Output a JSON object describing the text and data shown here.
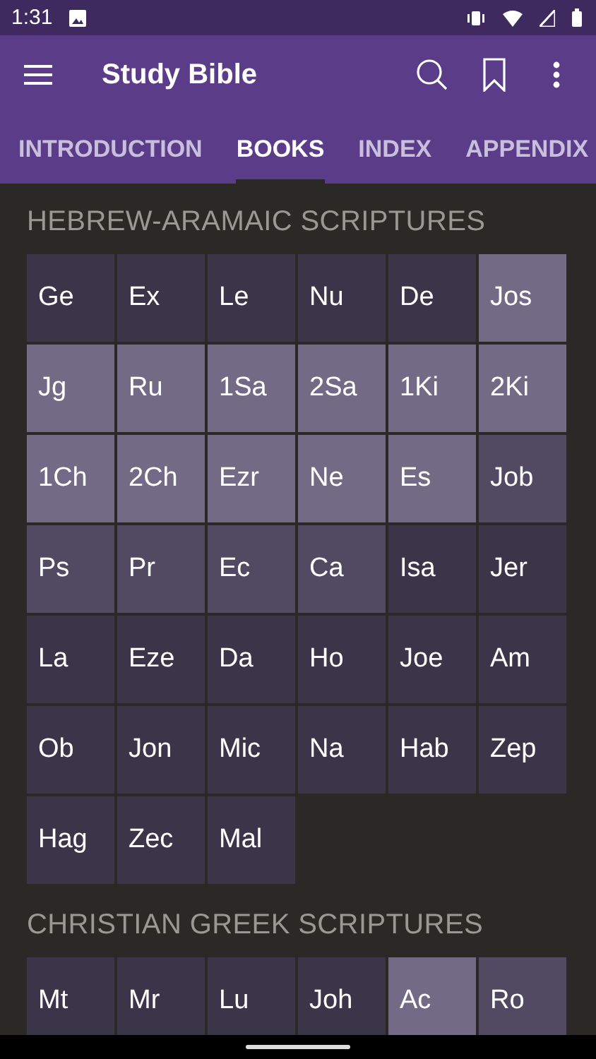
{
  "status_bar": {
    "time": "1:31"
  },
  "app_bar": {
    "title": "Study Bible"
  },
  "tabs": [
    {
      "label": "INTRODUCTION",
      "selected": false
    },
    {
      "label": "BOOKS",
      "selected": true
    },
    {
      "label": "INDEX",
      "selected": false
    },
    {
      "label": "APPENDIX",
      "selected": false
    }
  ],
  "sections": [
    {
      "heading": "HEBREW-ARAMAIC SCRIPTURES",
      "books": [
        {
          "label": "Ge",
          "color": "#3a3548"
        },
        {
          "label": "Ex",
          "color": "#3a3548"
        },
        {
          "label": "Le",
          "color": "#3a3548"
        },
        {
          "label": "Nu",
          "color": "#3a3548"
        },
        {
          "label": "De",
          "color": "#3a3548"
        },
        {
          "label": "Jos",
          "color": "#736b86"
        },
        {
          "label": "Jg",
          "color": "#736b86"
        },
        {
          "label": "Ru",
          "color": "#736b86"
        },
        {
          "label": "1Sa",
          "color": "#736b86"
        },
        {
          "label": "2Sa",
          "color": "#736b86"
        },
        {
          "label": "1Ki",
          "color": "#736b86"
        },
        {
          "label": "2Ki",
          "color": "#736b86"
        },
        {
          "label": "1Ch",
          "color": "#736b86"
        },
        {
          "label": "2Ch",
          "color": "#736b86"
        },
        {
          "label": "Ezr",
          "color": "#736b86"
        },
        {
          "label": "Ne",
          "color": "#736b86"
        },
        {
          "label": "Es",
          "color": "#736b86"
        },
        {
          "label": "Job",
          "color": "#524a63"
        },
        {
          "label": "Ps",
          "color": "#524a63"
        },
        {
          "label": "Pr",
          "color": "#524a63"
        },
        {
          "label": "Ec",
          "color": "#524a63"
        },
        {
          "label": "Ca",
          "color": "#524a63"
        },
        {
          "label": "Isa",
          "color": "#3a3548"
        },
        {
          "label": "Jer",
          "color": "#3a3548"
        },
        {
          "label": "La",
          "color": "#3a3548"
        },
        {
          "label": "Eze",
          "color": "#3a3548"
        },
        {
          "label": "Da",
          "color": "#3a3548"
        },
        {
          "label": "Ho",
          "color": "#3a3548"
        },
        {
          "label": "Joe",
          "color": "#3a3548"
        },
        {
          "label": "Am",
          "color": "#3a3548"
        },
        {
          "label": "Ob",
          "color": "#3a3548"
        },
        {
          "label": "Jon",
          "color": "#3a3548"
        },
        {
          "label": "Mic",
          "color": "#3a3548"
        },
        {
          "label": "Na",
          "color": "#3a3548"
        },
        {
          "label": "Hab",
          "color": "#3a3548"
        },
        {
          "label": "Zep",
          "color": "#3a3548"
        },
        {
          "label": "Hag",
          "color": "#3a3548"
        },
        {
          "label": "Zec",
          "color": "#3a3548"
        },
        {
          "label": "Mal",
          "color": "#3a3548"
        }
      ]
    },
    {
      "heading": "CHRISTIAN GREEK SCRIPTURES",
      "books": [
        {
          "label": "Mt",
          "color": "#3a3548"
        },
        {
          "label": "Mr",
          "color": "#3a3548"
        },
        {
          "label": "Lu",
          "color": "#3a3548"
        },
        {
          "label": "Joh",
          "color": "#3a3548"
        },
        {
          "label": "Ac",
          "color": "#736b86"
        },
        {
          "label": "Ro",
          "color": "#524a63"
        }
      ]
    }
  ]
}
